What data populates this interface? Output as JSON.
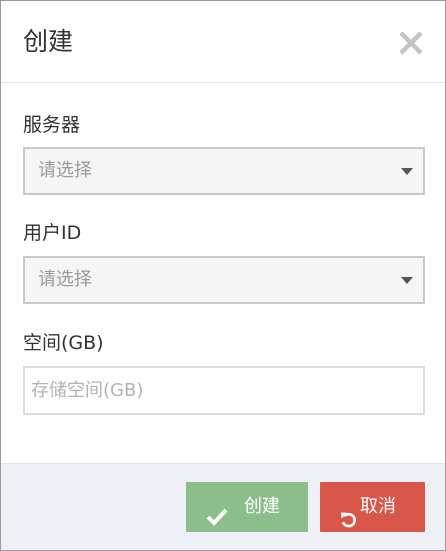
{
  "modal": {
    "title": "创建",
    "close_icon": "close-icon"
  },
  "form": {
    "server": {
      "label": "服务器",
      "selected": "请选择"
    },
    "user_id": {
      "label": "用户ID",
      "selected": "请选择"
    },
    "space": {
      "label": "空间(GB)",
      "placeholder": "存储空间(GB)",
      "value": ""
    }
  },
  "footer": {
    "create_label": "创建",
    "create_icon": "check-icon",
    "cancel_label": "取消",
    "cancel_icon": "undo-icon"
  },
  "colors": {
    "create_button": "#8cbe8c",
    "cancel_button": "#d9574a",
    "footer_background": "#eef0f5"
  }
}
